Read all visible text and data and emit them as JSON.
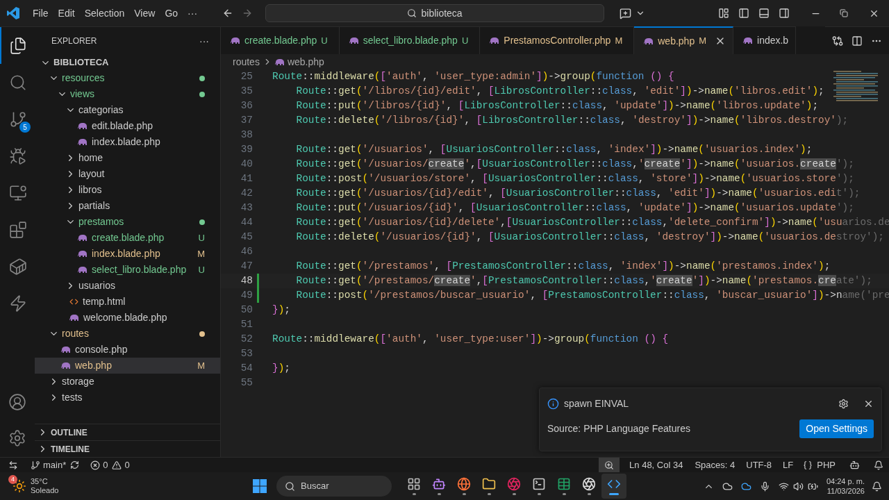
{
  "title_bar": {
    "menu": [
      "File",
      "Edit",
      "Selection",
      "View",
      "Go",
      "···"
    ],
    "search": "biblioteca"
  },
  "activity_bar": {
    "items": [
      {
        "selected": true
      },
      {
        "selected": false
      },
      {
        "selected": false,
        "badge": "5"
      },
      {
        "selected": false
      },
      {
        "selected": false
      },
      {
        "selected": false
      },
      {
        "selected": false
      },
      {
        "selected": false
      }
    ]
  },
  "sidebar": {
    "title": "EXPLORER",
    "more": "···",
    "root": {
      "label": "BIBLIOTECA",
      "expanded": true
    },
    "tree": [
      {
        "label": "resources",
        "kind": "folder",
        "expanded": true,
        "selected": false,
        "color": "#73c991",
        "dot": true,
        "children": [
          {
            "label": "views",
            "kind": "folder",
            "expanded": true,
            "selected": false,
            "color": "#73c991",
            "dot": true,
            "children": [
              {
                "label": "categorias",
                "kind": "folder",
                "expanded": true,
                "selected": false,
                "color": "#cccccc",
                "children": [
                  {
                    "label": "edit.blade.php",
                    "kind": "php",
                    "selected": false,
                    "color": "#cccccc"
                  },
                  {
                    "label": "index.blade.php",
                    "kind": "php",
                    "selected": false,
                    "color": "#cccccc"
                  }
                ]
              },
              {
                "label": "home",
                "kind": "folder",
                "expanded": false,
                "selected": false,
                "color": "#cccccc"
              },
              {
                "label": "layout",
                "kind": "folder",
                "expanded": false,
                "selected": false,
                "color": "#cccccc"
              },
              {
                "label": "libros",
                "kind": "folder",
                "expanded": false,
                "selected": false,
                "color": "#cccccc"
              },
              {
                "label": "partials",
                "kind": "folder",
                "expanded": false,
                "selected": false,
                "color": "#cccccc"
              },
              {
                "label": "prestamos",
                "kind": "folder",
                "expanded": true,
                "selected": false,
                "color": "#73c991",
                "dot": true,
                "children": [
                  {
                    "label": "create.blade.php",
                    "kind": "php",
                    "selected": false,
                    "color": "#73c991",
                    "badge": "U"
                  },
                  {
                    "label": "index.blade.php",
                    "kind": "php",
                    "selected": false,
                    "color": "#e2c08d",
                    "badge": "M"
                  },
                  {
                    "label": "select_libro.blade.php",
                    "kind": "php",
                    "selected": false,
                    "color": "#73c991",
                    "badge": "U"
                  }
                ]
              },
              {
                "label": "usuarios",
                "kind": "folder",
                "expanded": false,
                "selected": false,
                "color": "#cccccc"
              },
              {
                "label": "temp.html",
                "kind": "html",
                "selected": false,
                "color": "#cccccc"
              },
              {
                "label": "welcome.blade.php",
                "kind": "php",
                "selected": false,
                "color": "#cccccc"
              }
            ]
          }
        ]
      },
      {
        "label": "routes",
        "kind": "folder",
        "expanded": true,
        "selected": false,
        "color": "#e2c08d",
        "dot": true,
        "children": [
          {
            "label": "console.php",
            "kind": "php",
            "selected": false,
            "color": "#cccccc"
          },
          {
            "label": "web.php",
            "kind": "php",
            "selected": true,
            "color": "#e2c08d",
            "badge": "M"
          }
        ]
      },
      {
        "label": "storage",
        "kind": "folder",
        "expanded": false,
        "selected": false,
        "color": "#cccccc"
      },
      {
        "label": "tests",
        "kind": "folder",
        "expanded": false,
        "selected": false,
        "color": "#cccccc"
      }
    ],
    "sections": [
      {
        "label": "OUTLINE",
        "expanded": false
      },
      {
        "label": "TIMELINE",
        "expanded": false
      }
    ]
  },
  "editor": {
    "tabs": [
      {
        "label": "create.blade.php",
        "badge": "U",
        "color": "#73c991",
        "selected": false
      },
      {
        "label": "select_libro.blade.php",
        "badge": "U",
        "color": "#73c991",
        "selected": false
      },
      {
        "label": "PrestamosController.php",
        "badge": "M",
        "color": "#e2c08d",
        "selected": false
      },
      {
        "label": "web.php",
        "badge": "M",
        "color": "#e2c08d",
        "selected": true
      },
      {
        "label": "index.b",
        "color": "#cccccc",
        "selected": false
      }
    ],
    "breadcrumb": [
      "routes",
      "web.php"
    ],
    "lines": [
      {
        "number": "25",
        "tokens": [
          {
            "kind": "class",
            "text": "Route"
          },
          {
            "kind": "plain",
            "text": "::"
          },
          {
            "kind": "fn",
            "text": "middleware"
          },
          {
            "kind": "paren",
            "text": "("
          },
          {
            "kind": "bracket",
            "text": "["
          },
          {
            "kind": "str",
            "text": "'auth'"
          },
          {
            "kind": "plain",
            "text": ", "
          },
          {
            "kind": "str",
            "text": "'user_type:admin'"
          },
          {
            "kind": "bracket",
            "text": "]"
          },
          {
            "kind": "paren",
            "text": ")"
          },
          {
            "kind": "plain",
            "text": "->"
          },
          {
            "kind": "fn",
            "text": "group"
          },
          {
            "kind": "paren",
            "text": "("
          },
          {
            "kind": "kw",
            "text": "function "
          },
          {
            "kind": "bracket",
            "text": "() {"
          }
        ]
      },
      {
        "number": "35",
        "tokens": [
          {
            "kind": "class",
            "text": "    Route"
          },
          {
            "kind": "plain",
            "text": "::"
          },
          {
            "kind": "fn",
            "text": "get"
          },
          {
            "kind": "paren",
            "text": "("
          },
          {
            "kind": "str",
            "text": "'/libros/{id}/edit'"
          },
          {
            "kind": "plain",
            "text": ", "
          },
          {
            "kind": "bracket",
            "text": "["
          },
          {
            "kind": "class",
            "text": "LibrosController"
          },
          {
            "kind": "plain",
            "text": "::"
          },
          {
            "kind": "kw",
            "text": "class"
          },
          {
            "kind": "plain",
            "text": ", "
          },
          {
            "kind": "str",
            "text": "'edit'"
          },
          {
            "kind": "bracket",
            "text": "]"
          },
          {
            "kind": "paren",
            "text": ")"
          },
          {
            "kind": "plain",
            "text": "->"
          },
          {
            "kind": "fn",
            "text": "name"
          },
          {
            "kind": "paren",
            "text": "("
          },
          {
            "kind": "str",
            "text": "'libros.edit'"
          },
          {
            "kind": "paren",
            "text": ")"
          },
          {
            "kind": "plain",
            "text": ";"
          }
        ]
      },
      {
        "number": "36",
        "tokens": [
          {
            "kind": "class",
            "text": "    Route"
          },
          {
            "kind": "plain",
            "text": "::"
          },
          {
            "kind": "fn",
            "text": "put"
          },
          {
            "kind": "paren",
            "text": "("
          },
          {
            "kind": "str",
            "text": "'/libros/{id}'"
          },
          {
            "kind": "plain",
            "text": ", "
          },
          {
            "kind": "bracket",
            "text": "["
          },
          {
            "kind": "class",
            "text": "LibrosController"
          },
          {
            "kind": "plain",
            "text": "::"
          },
          {
            "kind": "kw",
            "text": "class"
          },
          {
            "kind": "plain",
            "text": ", "
          },
          {
            "kind": "str",
            "text": "'update'"
          },
          {
            "kind": "bracket",
            "text": "]"
          },
          {
            "kind": "paren",
            "text": ")"
          },
          {
            "kind": "plain",
            "text": "->"
          },
          {
            "kind": "fn",
            "text": "name"
          },
          {
            "kind": "paren",
            "text": "("
          },
          {
            "kind": "str",
            "text": "'libros.update'"
          },
          {
            "kind": "paren",
            "text": ")"
          },
          {
            "kind": "plain",
            "text": ";"
          }
        ]
      },
      {
        "number": "37",
        "tokens": [
          {
            "kind": "class",
            "text": "    Route"
          },
          {
            "kind": "plain",
            "text": "::"
          },
          {
            "kind": "fn",
            "text": "delete"
          },
          {
            "kind": "paren",
            "text": "("
          },
          {
            "kind": "str",
            "text": "'/libros/{id}'"
          },
          {
            "kind": "plain",
            "text": ", "
          },
          {
            "kind": "bracket",
            "text": "["
          },
          {
            "kind": "class",
            "text": "LibrosController"
          },
          {
            "kind": "plain",
            "text": "::"
          },
          {
            "kind": "kw",
            "text": "class"
          },
          {
            "kind": "plain",
            "text": ", "
          },
          {
            "kind": "str",
            "text": "'destroy'"
          },
          {
            "kind": "bracket",
            "text": "]"
          },
          {
            "kind": "paren",
            "text": ")"
          },
          {
            "kind": "plain",
            "text": "->"
          },
          {
            "kind": "fn",
            "text": "name"
          },
          {
            "kind": "paren",
            "text": "("
          },
          {
            "kind": "str",
            "text": "'libros.destroy'"
          },
          {
            "kind": "faded",
            "text": ");"
          }
        ]
      },
      {
        "number": "38"
      },
      {
        "number": "39",
        "tokens": [
          {
            "kind": "class",
            "text": "    Route"
          },
          {
            "kind": "plain",
            "text": "::"
          },
          {
            "kind": "fn",
            "text": "get"
          },
          {
            "kind": "paren",
            "text": "("
          },
          {
            "kind": "str",
            "text": "'/usuarios'"
          },
          {
            "kind": "plain",
            "text": ", "
          },
          {
            "kind": "bracket",
            "text": "["
          },
          {
            "kind": "class",
            "text": "UsuariosController"
          },
          {
            "kind": "plain",
            "text": "::"
          },
          {
            "kind": "kw",
            "text": "class"
          },
          {
            "kind": "plain",
            "text": ", "
          },
          {
            "kind": "str",
            "text": "'index'"
          },
          {
            "kind": "bracket",
            "text": "]"
          },
          {
            "kind": "paren",
            "text": ")"
          },
          {
            "kind": "plain",
            "text": "->"
          },
          {
            "kind": "fn",
            "text": "name"
          },
          {
            "kind": "paren",
            "text": "("
          },
          {
            "kind": "str",
            "text": "'usuarios.index'"
          },
          {
            "kind": "paren",
            "text": ")"
          },
          {
            "kind": "plain",
            "text": ";"
          }
        ]
      },
      {
        "number": "40",
        "tokens": [
          {
            "kind": "class",
            "text": "    Route"
          },
          {
            "kind": "plain",
            "text": "::"
          },
          {
            "kind": "fn",
            "text": "get"
          },
          {
            "kind": "paren",
            "text": "("
          },
          {
            "kind": "str",
            "text": "'/usuarios/"
          },
          {
            "kind": "match",
            "text": "create"
          },
          {
            "kind": "str",
            "text": "'"
          },
          {
            "kind": "plain",
            "text": ","
          },
          {
            "kind": "bracket",
            "text": "["
          },
          {
            "kind": "class",
            "text": "UsuariosController"
          },
          {
            "kind": "plain",
            "text": "::"
          },
          {
            "kind": "kw",
            "text": "class"
          },
          {
            "kind": "plain",
            "text": ","
          },
          {
            "kind": "str",
            "text": "'"
          },
          {
            "kind": "match",
            "text": "create"
          },
          {
            "kind": "str",
            "text": "'"
          },
          {
            "kind": "bracket",
            "text": "]"
          },
          {
            "kind": "paren",
            "text": ")"
          },
          {
            "kind": "plain",
            "text": "->"
          },
          {
            "kind": "fn",
            "text": "name"
          },
          {
            "kind": "paren",
            "text": "("
          },
          {
            "kind": "str",
            "text": "'usuarios."
          },
          {
            "kind": "match",
            "text": "create"
          },
          {
            "kind": "faded",
            "text": "');"
          }
        ]
      },
      {
        "number": "41",
        "tokens": [
          {
            "kind": "class",
            "text": "    Route"
          },
          {
            "kind": "plain",
            "text": "::"
          },
          {
            "kind": "fn",
            "text": "post"
          },
          {
            "kind": "paren",
            "text": "("
          },
          {
            "kind": "str",
            "text": "'/usuarios/store'"
          },
          {
            "kind": "plain",
            "text": ", "
          },
          {
            "kind": "bracket",
            "text": "["
          },
          {
            "kind": "class",
            "text": "UsuariosController"
          },
          {
            "kind": "plain",
            "text": "::"
          },
          {
            "kind": "kw",
            "text": "class"
          },
          {
            "kind": "plain",
            "text": ", "
          },
          {
            "kind": "str",
            "text": "'store'"
          },
          {
            "kind": "bracket",
            "text": "]"
          },
          {
            "kind": "paren",
            "text": ")"
          },
          {
            "kind": "plain",
            "text": "->"
          },
          {
            "kind": "fn",
            "text": "name"
          },
          {
            "kind": "paren",
            "text": "("
          },
          {
            "kind": "str",
            "text": "'usuarios.store"
          },
          {
            "kind": "faded",
            "text": "');"
          }
        ]
      },
      {
        "number": "42",
        "tokens": [
          {
            "kind": "class",
            "text": "    Route"
          },
          {
            "kind": "plain",
            "text": "::"
          },
          {
            "kind": "fn",
            "text": "get"
          },
          {
            "kind": "paren",
            "text": "("
          },
          {
            "kind": "str",
            "text": "'/usuarios/{id}/edit'"
          },
          {
            "kind": "plain",
            "text": ", "
          },
          {
            "kind": "bracket",
            "text": "["
          },
          {
            "kind": "class",
            "text": "UsuariosController"
          },
          {
            "kind": "plain",
            "text": "::"
          },
          {
            "kind": "kw",
            "text": "class"
          },
          {
            "kind": "plain",
            "text": ", "
          },
          {
            "kind": "str",
            "text": "'edit'"
          },
          {
            "kind": "bracket",
            "text": "]"
          },
          {
            "kind": "paren",
            "text": ")"
          },
          {
            "kind": "plain",
            "text": "->"
          },
          {
            "kind": "fn",
            "text": "name"
          },
          {
            "kind": "paren",
            "text": "("
          },
          {
            "kind": "str",
            "text": "'usuarios.edi"
          },
          {
            "kind": "faded",
            "text": "t');"
          }
        ]
      },
      {
        "number": "43",
        "tokens": [
          {
            "kind": "class",
            "text": "    Route"
          },
          {
            "kind": "plain",
            "text": "::"
          },
          {
            "kind": "fn",
            "text": "put"
          },
          {
            "kind": "paren",
            "text": "("
          },
          {
            "kind": "str",
            "text": "'/usuarios/{id}'"
          },
          {
            "kind": "plain",
            "text": ", "
          },
          {
            "kind": "bracket",
            "text": "["
          },
          {
            "kind": "class",
            "text": "UsuariosController"
          },
          {
            "kind": "plain",
            "text": "::"
          },
          {
            "kind": "kw",
            "text": "class"
          },
          {
            "kind": "plain",
            "text": ", "
          },
          {
            "kind": "str",
            "text": "'update'"
          },
          {
            "kind": "bracket",
            "text": "]"
          },
          {
            "kind": "paren",
            "text": ")"
          },
          {
            "kind": "plain",
            "text": "->"
          },
          {
            "kind": "fn",
            "text": "name"
          },
          {
            "kind": "paren",
            "text": "("
          },
          {
            "kind": "str",
            "text": "'usuarios.update"
          },
          {
            "kind": "faded",
            "text": "');"
          }
        ]
      },
      {
        "number": "44",
        "tokens": [
          {
            "kind": "class",
            "text": "    Route"
          },
          {
            "kind": "plain",
            "text": "::"
          },
          {
            "kind": "fn",
            "text": "get"
          },
          {
            "kind": "paren",
            "text": "("
          },
          {
            "kind": "str",
            "text": "'/usuarios/{id}/delete'"
          },
          {
            "kind": "plain",
            "text": ","
          },
          {
            "kind": "bracket",
            "text": "["
          },
          {
            "kind": "class",
            "text": "UsuariosController"
          },
          {
            "kind": "plain",
            "text": "::"
          },
          {
            "kind": "kw",
            "text": "class"
          },
          {
            "kind": "plain",
            "text": ","
          },
          {
            "kind": "str",
            "text": "'delete_confirm'"
          },
          {
            "kind": "bracket",
            "text": "]"
          },
          {
            "kind": "paren",
            "text": ")"
          },
          {
            "kind": "plain",
            "text": "->"
          },
          {
            "kind": "fn",
            "text": "name"
          },
          {
            "kind": "paren",
            "text": "("
          },
          {
            "kind": "str",
            "text": "'usu"
          },
          {
            "kind": "faded",
            "text": "arios.de"
          }
        ]
      },
      {
        "number": "45",
        "tokens": [
          {
            "kind": "class",
            "text": "    Route"
          },
          {
            "kind": "plain",
            "text": "::"
          },
          {
            "kind": "fn",
            "text": "delete"
          },
          {
            "kind": "paren",
            "text": "("
          },
          {
            "kind": "str",
            "text": "'/usuarios/{id}'"
          },
          {
            "kind": "plain",
            "text": ", "
          },
          {
            "kind": "bracket",
            "text": "["
          },
          {
            "kind": "class",
            "text": "UsuariosController"
          },
          {
            "kind": "plain",
            "text": "::"
          },
          {
            "kind": "kw",
            "text": "class"
          },
          {
            "kind": "plain",
            "text": ", "
          },
          {
            "kind": "str",
            "text": "'destroy'"
          },
          {
            "kind": "bracket",
            "text": "]"
          },
          {
            "kind": "paren",
            "text": ")"
          },
          {
            "kind": "plain",
            "text": "->"
          },
          {
            "kind": "fn",
            "text": "name"
          },
          {
            "kind": "paren",
            "text": "("
          },
          {
            "kind": "str",
            "text": "'usuarios.de"
          },
          {
            "kind": "faded",
            "text": "stroy');"
          }
        ]
      },
      {
        "number": "46"
      },
      {
        "number": "47",
        "tokens": [
          {
            "kind": "class",
            "text": "    Route"
          },
          {
            "kind": "plain",
            "text": "::"
          },
          {
            "kind": "fn",
            "text": "get"
          },
          {
            "kind": "paren",
            "text": "("
          },
          {
            "kind": "str",
            "text": "'/prestamos'"
          },
          {
            "kind": "plain",
            "text": ", "
          },
          {
            "kind": "bracket",
            "text": "["
          },
          {
            "kind": "class",
            "text": "PrestamosController"
          },
          {
            "kind": "plain",
            "text": "::"
          },
          {
            "kind": "kw",
            "text": "class"
          },
          {
            "kind": "plain",
            "text": ", "
          },
          {
            "kind": "str",
            "text": "'index'"
          },
          {
            "kind": "bracket",
            "text": "]"
          },
          {
            "kind": "paren",
            "text": ")"
          },
          {
            "kind": "plain",
            "text": "->"
          },
          {
            "kind": "fn",
            "text": "name"
          },
          {
            "kind": "paren",
            "text": "("
          },
          {
            "kind": "str",
            "text": "'prestamos.index'"
          },
          {
            "kind": "paren",
            "text": ")"
          },
          {
            "kind": "plain",
            "text": ";"
          }
        ]
      },
      {
        "number": "48",
        "modified": true,
        "current": true,
        "tokens": [
          {
            "kind": "class",
            "text": "    Route"
          },
          {
            "kind": "plain",
            "text": "::"
          },
          {
            "kind": "fn",
            "text": "get"
          },
          {
            "kind": "paren",
            "text": "("
          },
          {
            "kind": "str",
            "text": "'/prestamos/"
          },
          {
            "kind": "match",
            "text": "create"
          },
          {
            "kind": "str",
            "text": "'"
          },
          {
            "kind": "plain",
            "text": ","
          },
          {
            "kind": "bracket",
            "text": "["
          },
          {
            "kind": "class",
            "text": "PrestamosController"
          },
          {
            "kind": "plain",
            "text": "::"
          },
          {
            "kind": "kw",
            "text": "class"
          },
          {
            "kind": "plain",
            "text": ","
          },
          {
            "kind": "str",
            "text": "'"
          },
          {
            "kind": "match",
            "text": "create"
          },
          {
            "kind": "str",
            "text": "'"
          },
          {
            "kind": "bracket",
            "text": "]"
          },
          {
            "kind": "paren",
            "text": ")"
          },
          {
            "kind": "plain",
            "text": "->"
          },
          {
            "kind": "fn",
            "text": "name"
          },
          {
            "kind": "paren",
            "text": "("
          },
          {
            "kind": "str",
            "text": "'prestamos."
          },
          {
            "kind": "match",
            "text": "cre"
          },
          {
            "kind": "faded",
            "text": "ate');"
          }
        ]
      },
      {
        "number": "49",
        "modified": true,
        "tokens": [
          {
            "kind": "class",
            "text": "    Route"
          },
          {
            "kind": "plain",
            "text": "::"
          },
          {
            "kind": "fn",
            "text": "post"
          },
          {
            "kind": "paren",
            "text": "("
          },
          {
            "kind": "str",
            "text": "'/prestamos/buscar_usuario'"
          },
          {
            "kind": "plain",
            "text": ", "
          },
          {
            "kind": "bracket",
            "text": "["
          },
          {
            "kind": "class",
            "text": "PrestamosController"
          },
          {
            "kind": "plain",
            "text": "::"
          },
          {
            "kind": "kw",
            "text": "class"
          },
          {
            "kind": "plain",
            "text": ", "
          },
          {
            "kind": "str",
            "text": "'buscar_usuario'"
          },
          {
            "kind": "bracket",
            "text": "]"
          },
          {
            "kind": "paren",
            "text": ")"
          },
          {
            "kind": "plain",
            "text": "->n"
          },
          {
            "kind": "faded",
            "text": "ame('pre"
          }
        ]
      },
      {
        "number": "50",
        "tokens": [
          {
            "kind": "bracket",
            "text": "}"
          },
          {
            "kind": "paren",
            "text": ")"
          },
          {
            "kind": "plain",
            "text": ";"
          }
        ]
      },
      {
        "number": "51"
      },
      {
        "number": "52",
        "tokens": [
          {
            "kind": "class",
            "text": "Route"
          },
          {
            "kind": "plain",
            "text": "::"
          },
          {
            "kind": "fn",
            "text": "middleware"
          },
          {
            "kind": "paren",
            "text": "("
          },
          {
            "kind": "bracket",
            "text": "["
          },
          {
            "kind": "str",
            "text": "'auth'"
          },
          {
            "kind": "plain",
            "text": ", "
          },
          {
            "kind": "str",
            "text": "'user_type:user'"
          },
          {
            "kind": "bracket",
            "text": "]"
          },
          {
            "kind": "paren",
            "text": ")"
          },
          {
            "kind": "plain",
            "text": "->"
          },
          {
            "kind": "fn",
            "text": "group"
          },
          {
            "kind": "paren",
            "text": "("
          },
          {
            "kind": "kw",
            "text": "function "
          },
          {
            "kind": "bracket",
            "text": "() {"
          }
        ]
      },
      {
        "number": "53"
      },
      {
        "number": "54",
        "tokens": [
          {
            "kind": "bracket",
            "text": "}"
          },
          {
            "kind": "paren",
            "text": ")"
          },
          {
            "kind": "plain",
            "text": ";"
          }
        ]
      },
      {
        "number": "55"
      }
    ]
  },
  "notification": {
    "message": "spawn EINVAL",
    "source": "Source: PHP Language Features",
    "button": "Open Settings"
  },
  "status_bar": {
    "branch": "main*",
    "errors": "0",
    "warnings": "0",
    "position": "Ln 48, Col 34",
    "indent": "Spaces: 4",
    "encoding": "UTF-8",
    "eol": "LF",
    "language": "PHP"
  },
  "taskbar": {
    "weather": {
      "badge": "4",
      "temp": "35°C",
      "condition": "Soleado"
    },
    "search": "Buscar",
    "apps": [
      {
        "active": false
      },
      {
        "active": false
      },
      {
        "active": false
      },
      {
        "active": false
      },
      {
        "active": false
      },
      {
        "active": false
      },
      {
        "active": false
      },
      {
        "active": false
      },
      {
        "active": true
      }
    ],
    "time": "04:24 p. m.",
    "date": "11/03/2026"
  }
}
